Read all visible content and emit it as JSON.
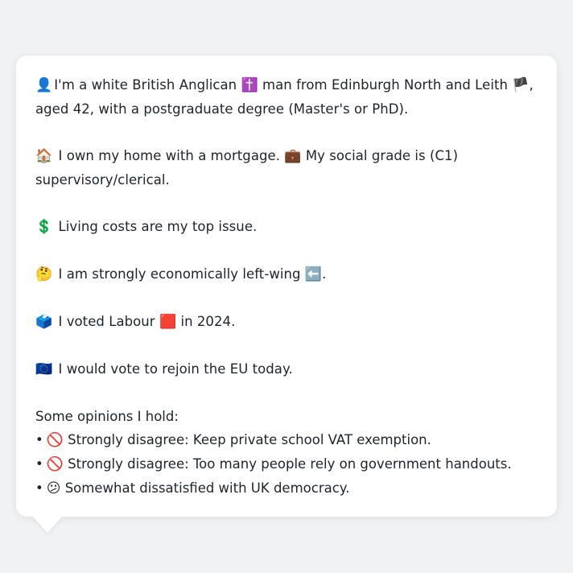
{
  "profile": {
    "p1": {
      "emoji": "👤",
      "text_a": "I'm a white British Anglican ",
      "emoji_religion": "✝️",
      "text_b": " man from Edinburgh North and Leith ",
      "emoji_flag": "🏴",
      "text_c": ",",
      "line2": "aged 42, with a postgraduate degree (Master's or PhD)."
    },
    "p2": {
      "emoji_home": "🏠",
      "text_a": " I own my home with a mortgage. ",
      "emoji_work": "💼",
      "text_b": " My social grade is (C1)",
      "line2": "supervisory/clerical."
    },
    "p3": {
      "emoji": "💲",
      "text": " Living costs are my top issue."
    },
    "p4": {
      "emoji": "🤔",
      "text_a": " I am strongly economically left-wing ",
      "emoji_arrow": "⬅️",
      "text_b": "."
    },
    "p5": {
      "emoji": "🗳️",
      "text_a": " I voted Labour ",
      "emoji_party": "🟥",
      "text_b": " in 2024."
    },
    "p6": {
      "emoji": "🇪🇺",
      "text": " I would vote to rejoin the EU today."
    },
    "opinions": {
      "title": "Some opinions I hold:",
      "items": [
        {
          "bullet": "•",
          "emoji": "🚫",
          "text": " Strongly disagree: Keep private school VAT exemption."
        },
        {
          "bullet": "•",
          "emoji": "🚫",
          "text": " Strongly disagree: Too many people rely on government handouts."
        },
        {
          "bullet": "•",
          "emoji": "😕",
          "text": " Somewhat dissatisfied with UK democracy."
        }
      ]
    }
  },
  "colors": {
    "background": "#f1f2f4",
    "card": "#ffffff",
    "text": "#1f2328"
  }
}
